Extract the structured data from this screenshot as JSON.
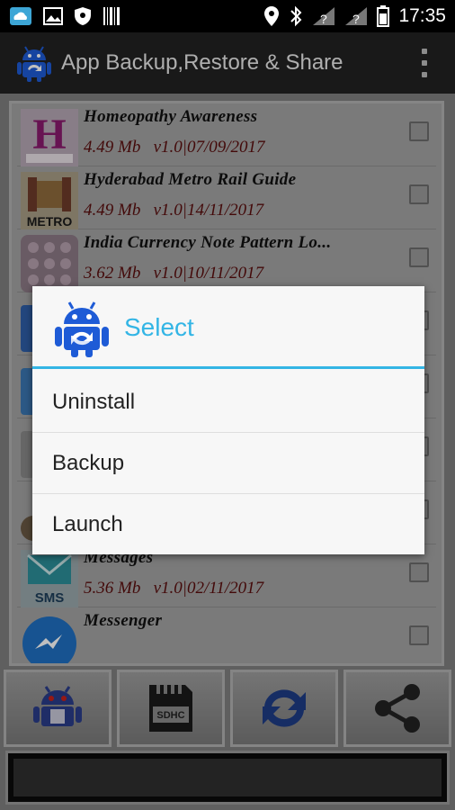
{
  "status_bar": {
    "time": "17:35",
    "icons": [
      "cloud-icon",
      "image-icon",
      "shield-icon",
      "barcode-icon",
      "location-icon",
      "bluetooth-icon",
      "signal-1-icon",
      "signal-2-icon",
      "battery-icon"
    ]
  },
  "action_bar": {
    "title": "App Backup,Restore & Share",
    "app_icon": "android-robot-icon",
    "menu_icon": "overflow-menu-icon"
  },
  "app_list": [
    {
      "name": "Homeopathy Awareness",
      "meta": "4.49 Mb   v1.0|07/09/2017",
      "icon": "homeopathy-icon"
    },
    {
      "name": "Hyderabad Metro Rail Guide",
      "meta": "4.49 Mb   v1.0|14/11/2017",
      "icon": "metro-icon"
    },
    {
      "name": "India Currency Note Pattern Lo...",
      "meta": "3.62 Mb   v1.0|10/11/2017",
      "icon": "pattern-lock-icon"
    },
    {
      "name": "",
      "meta": "",
      "icon": "app-icon"
    },
    {
      "name": "",
      "meta": "",
      "icon": "app-icon"
    },
    {
      "name": "",
      "meta": "",
      "icon": "app-icon"
    },
    {
      "name": "",
      "meta": "",
      "icon": "app-icon"
    },
    {
      "name": "Messages",
      "meta": "5.36 Mb   v1.0|02/11/2017",
      "icon": "sms-icon"
    },
    {
      "name": "Messenger",
      "meta": "",
      "icon": "messenger-icon"
    }
  ],
  "bottom_buttons": [
    {
      "name": "uninstall-button",
      "icon": "android-uninstall-icon"
    },
    {
      "name": "sd-card-button",
      "icon": "sd-card-icon"
    },
    {
      "name": "restore-button",
      "icon": "refresh-icon"
    },
    {
      "name": "share-button",
      "icon": "share-icon"
    }
  ],
  "dialog": {
    "title": "Select",
    "icon": "android-robot-icon",
    "items": [
      "Uninstall",
      "Backup",
      "Launch"
    ]
  },
  "colors": {
    "accent": "#33b5e5",
    "meta_text": "#5a0d0d",
    "overlay_bg": "#f7f7f7"
  }
}
